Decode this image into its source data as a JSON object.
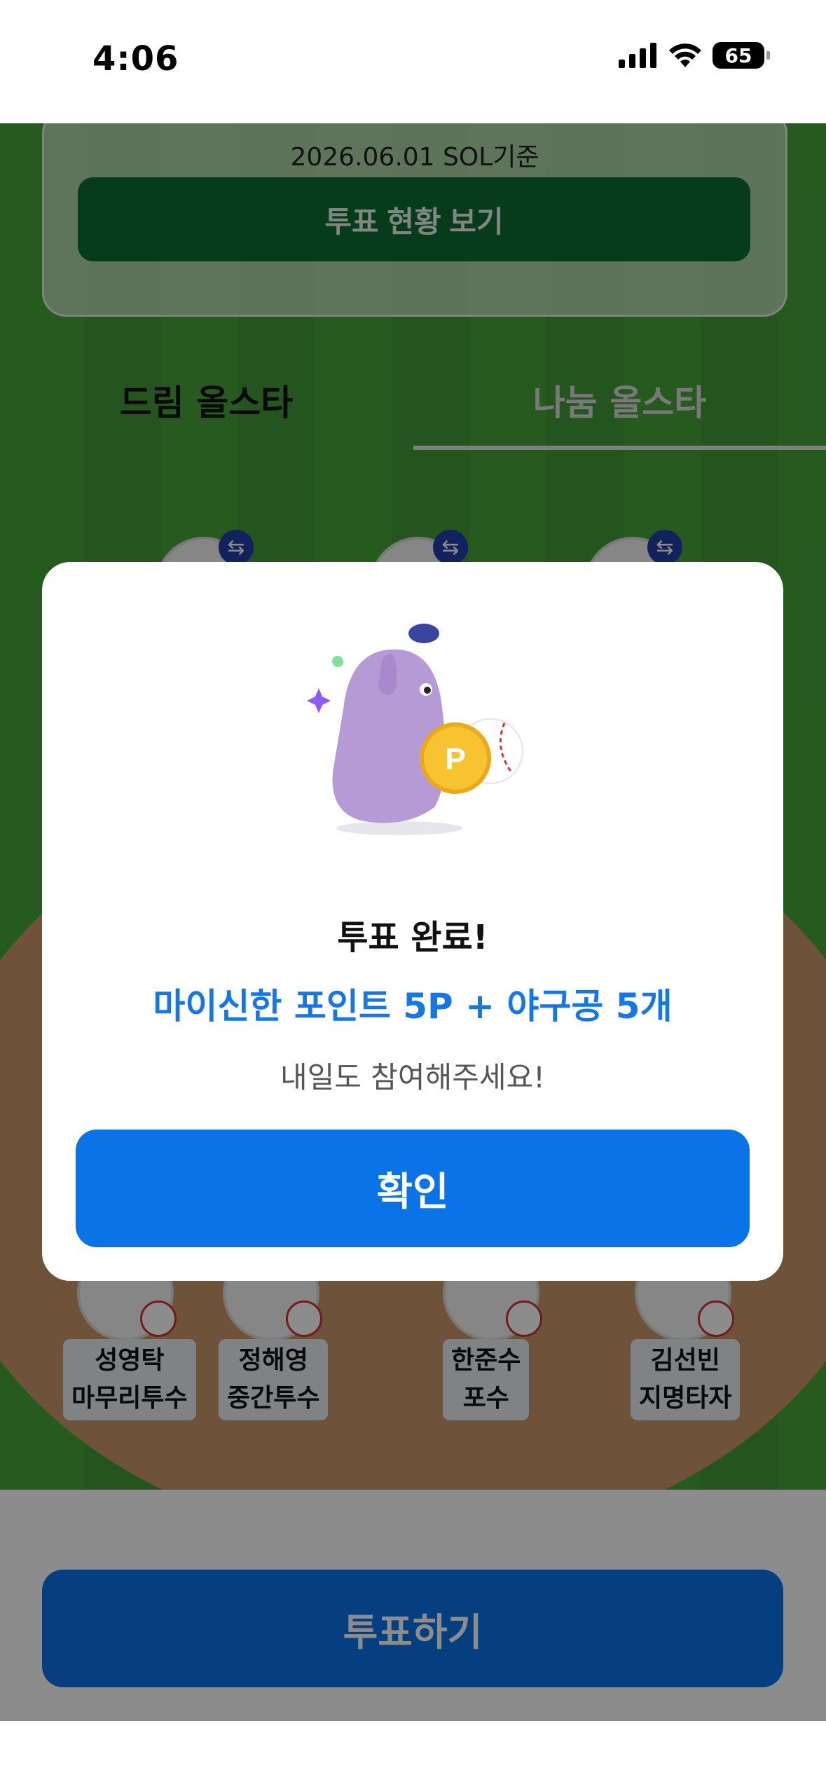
{
  "status_bar": {
    "time": "4:06",
    "battery": "65"
  },
  "info_card": {
    "date_text": "2026.06.01 SOL기준",
    "status_button": "투표 현황 보기"
  },
  "tabs": [
    {
      "label": "드림 올스타"
    },
    {
      "label": "나눔 올스타"
    }
  ],
  "players": [
    {
      "name": "성영탁",
      "position": "마무리투수"
    },
    {
      "name": "정해영",
      "position": "중간투수"
    },
    {
      "name": "한준수",
      "position": "포수"
    },
    {
      "name": "김선빈",
      "position": "지명타자"
    }
  ],
  "vote_button": "투표하기",
  "modal": {
    "title": "투표 완료!",
    "reward": "마이신한 포인트 5P + 야구공 5개",
    "subtitle": "내일도 참여해주세요!",
    "confirm": "확인",
    "coin_label": "P"
  },
  "colors": {
    "accent": "#0a73e8",
    "reward_text": "#1577e6",
    "field_green": "#46a43a"
  }
}
